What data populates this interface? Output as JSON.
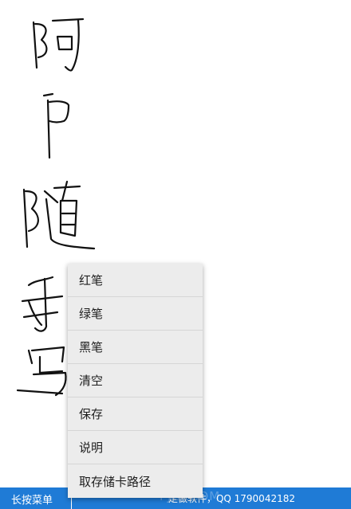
{
  "menu": {
    "items": [
      {
        "label": "红笔"
      },
      {
        "label": "绿笔"
      },
      {
        "label": "黑笔"
      },
      {
        "label": "清空"
      },
      {
        "label": "保存"
      },
      {
        "label": "说明"
      },
      {
        "label": "取存储卡路径"
      }
    ]
  },
  "bottom_bar": {
    "left_label": "长按菜单",
    "right_label": "定做软件，QQ 1790042182",
    "watermark": "PJZJ.COM"
  },
  "colors": {
    "bar": "#1f7bd6",
    "menu_bg": "#ececec",
    "ink": "#111111"
  }
}
